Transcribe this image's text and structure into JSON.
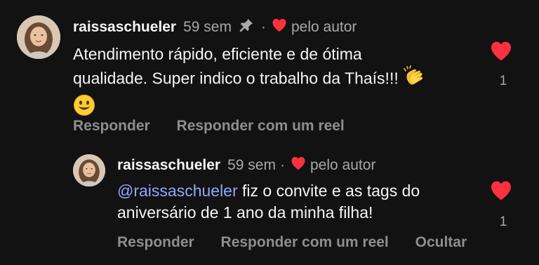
{
  "comments": [
    {
      "username": "raissaschueler",
      "time": "59 sem",
      "pinned": true,
      "author_like_label": "pelo autor",
      "text": "Atendimento rápido, eficiente e de ótima qualidade. Super indico o trabalho da Thaís!!!",
      "emojis": [
        "clapping-hands",
        "smiling-face"
      ],
      "like_count": "1",
      "actions": [
        "Responder",
        "Responder com um reel"
      ]
    }
  ],
  "reply": {
    "username": "raissaschueler",
    "time": "59 sem",
    "author_like_label": "pelo autor",
    "mention": "@raissaschueler",
    "text": " fiz o convite e as tags do aniversário de 1 ano da minha filha!",
    "like_count": "1",
    "actions": [
      "Responder",
      "Responder com um reel",
      "Ocultar"
    ]
  },
  "colors": {
    "background": "#121212",
    "heart": "#ff3040",
    "mention": "#8fa8ff",
    "muted": "#a8a8a8"
  }
}
